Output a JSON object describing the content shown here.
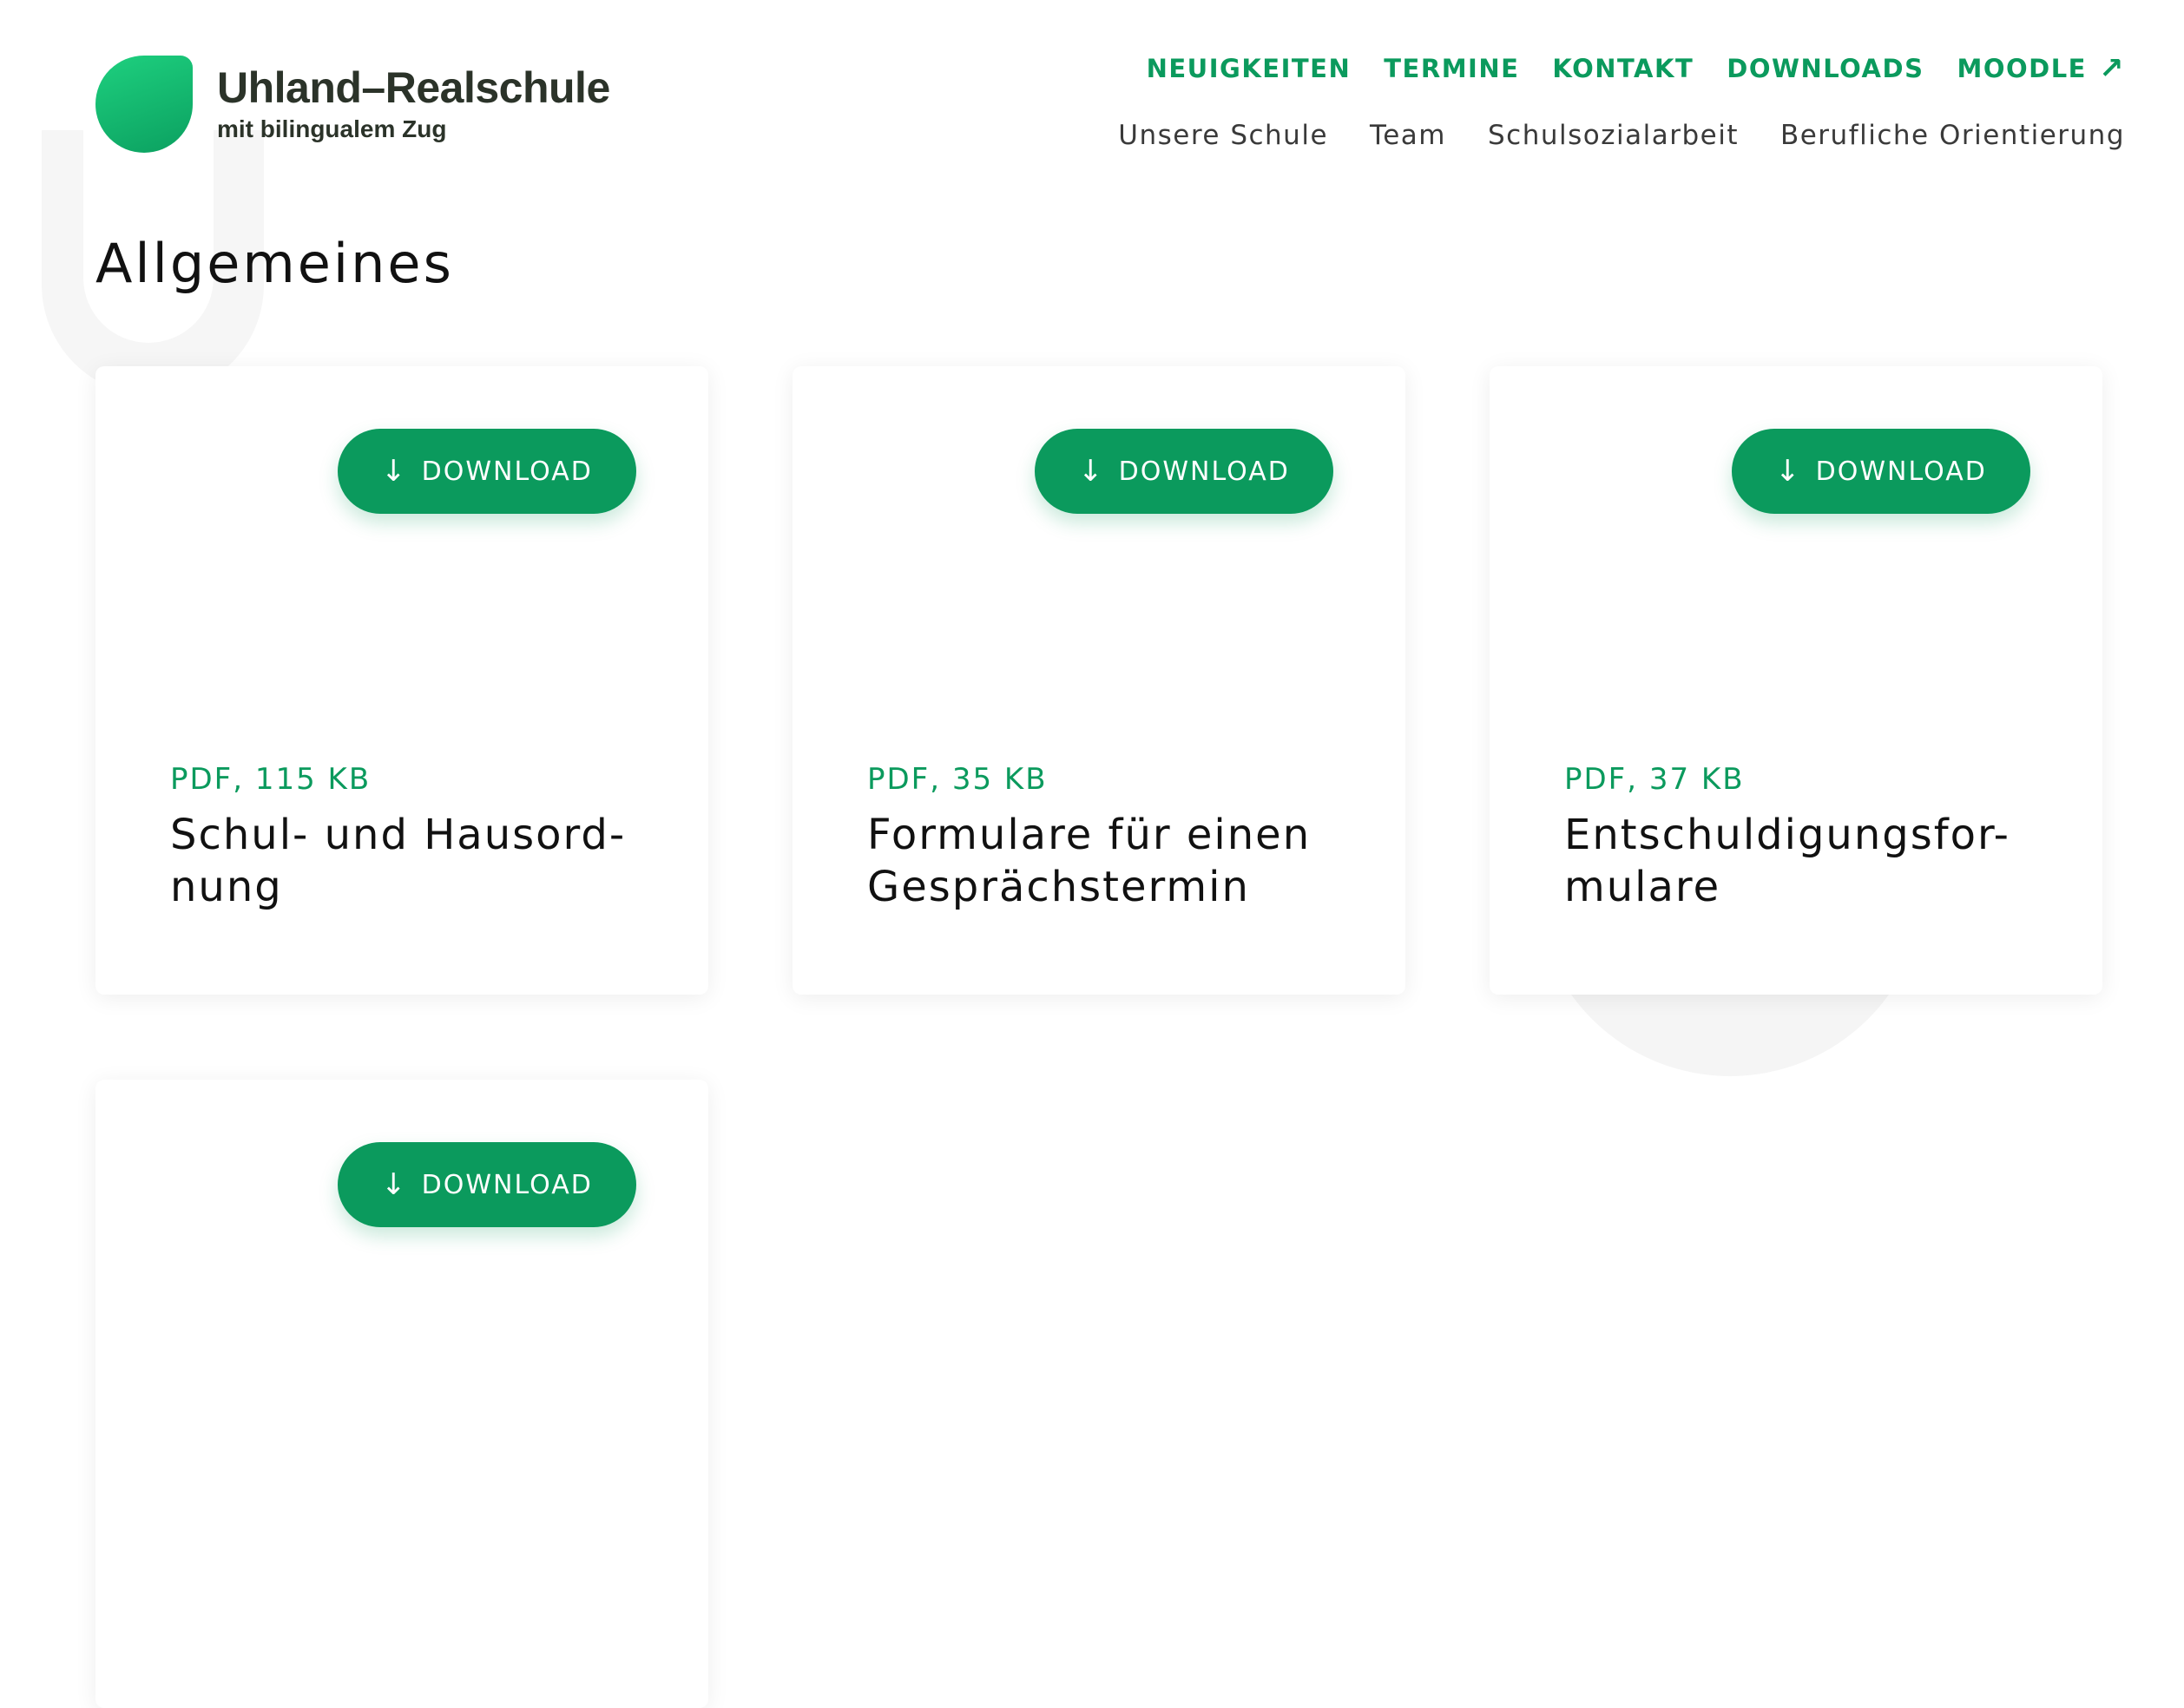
{
  "header": {
    "logo_title": "Uhland–Realschule",
    "logo_subtitle": "mit bilingualem Zug",
    "primary_nav": [
      {
        "label": "NEUIGKEITEN"
      },
      {
        "label": "TERMINE"
      },
      {
        "label": "KONTAKT"
      },
      {
        "label": "DOWNLOADS"
      },
      {
        "label": "MOODLE",
        "icon": "external-link-arrow-icon"
      }
    ],
    "secondary_nav": [
      {
        "label": "Unsere Schule"
      },
      {
        "label": "Team"
      },
      {
        "label": "Schulsozialarbeit"
      },
      {
        "label": "Berufliche Orientierung"
      }
    ]
  },
  "main": {
    "heading": "Allgemeines",
    "download_label": "DOWNLOAD",
    "download_icon": "arrow-down-icon",
    "cards": [
      {
        "meta": "PDF, 115 KB",
        "title": "Schul- und Hausord-\nnung"
      },
      {
        "meta": "PDF, 35 KB",
        "title": "Formulare für einen\nGesprächstermin"
      },
      {
        "meta": "PDF, 37 KB",
        "title": "Entschuldigungsfor-\nmulare"
      },
      {
        "meta": "",
        "title": ""
      }
    ]
  },
  "colors": {
    "accent": "#0b9a5d",
    "logo_gradient_start": "#1ed07f",
    "logo_gradient_end": "#0ba060",
    "text_dark": "#111111"
  }
}
